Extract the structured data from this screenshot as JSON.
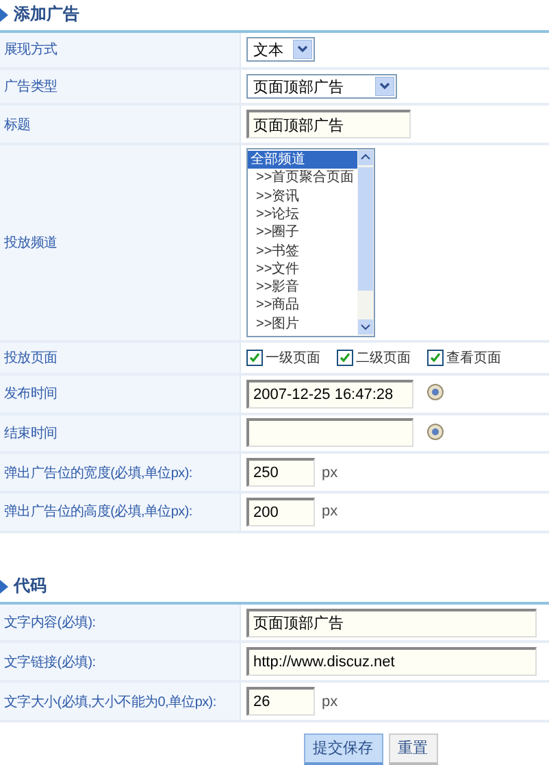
{
  "sections": [
    {
      "title": "添加广告",
      "rows": [
        {
          "kind": "select",
          "label": "展现方式",
          "value": "文本"
        },
        {
          "kind": "select",
          "label": "广告类型",
          "value": "页面顶部广告"
        },
        {
          "kind": "text",
          "label": "标题",
          "value": "页面顶部广告"
        },
        {
          "kind": "listbox",
          "label": "投放频道",
          "options": [
            {
              "label": "全部频道",
              "selected": true
            },
            {
              "label": ">>首页聚合页面",
              "selected": false
            },
            {
              "label": ">>资讯",
              "selected": false
            },
            {
              "label": ">>论坛",
              "selected": false
            },
            {
              "label": ">>圈子",
              "selected": false
            },
            {
              "label": ">>书签",
              "selected": false
            },
            {
              "label": ">>文件",
              "selected": false
            },
            {
              "label": ">>影音",
              "selected": false
            },
            {
              "label": ">>商品",
              "selected": false
            },
            {
              "label": ">>图片",
              "selected": false
            }
          ]
        },
        {
          "kind": "checkboxes",
          "label": "投放页面",
          "options": [
            {
              "label": "一级页面",
              "checked": true
            },
            {
              "label": "二级页面",
              "checked": true
            },
            {
              "label": "查看页面",
              "checked": true
            }
          ]
        },
        {
          "kind": "datetime",
          "label": "发布时间",
          "value": "2007-12-25 16:47:28"
        },
        {
          "kind": "datetime",
          "label": "结束时间"
        },
        {
          "kind": "text",
          "label": "弹出广告位的宽度(必填,单位px):",
          "value": "250",
          "unit": "px"
        },
        {
          "kind": "text",
          "label": "弹出广告位的高度(必填,单位px):",
          "value": "200",
          "unit": "px"
        }
      ]
    },
    {
      "title": "代码",
      "rows": [
        {
          "kind": "text",
          "label": "文字内容(必填):",
          "value": "页面顶部广告"
        },
        {
          "kind": "text",
          "label": "文字链接(必填):",
          "value": "http://www.discuz.net"
        },
        {
          "kind": "text",
          "label": "文字大小(必填,大小不能为0,单位px):",
          "value": "26",
          "unit": "px"
        }
      ]
    }
  ],
  "buttons": [
    {
      "label": "提交保存",
      "kind": "primary"
    },
    {
      "label": "重置",
      "kind": "secondary"
    }
  ]
}
